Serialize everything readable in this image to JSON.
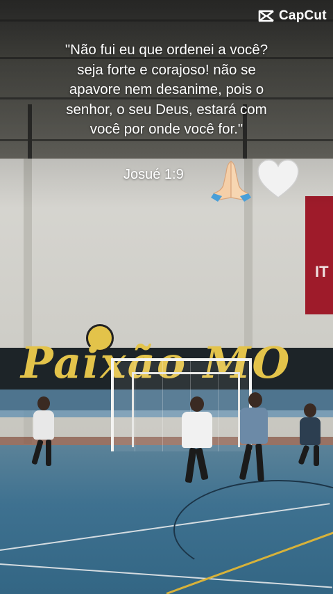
{
  "watermark": {
    "brand": "CapCut",
    "icon": "capcut-logo-icon"
  },
  "quote": {
    "lines": [
      "\"Não fui eu que ordenei a você?",
      "seja forte e corajoso! não se",
      "apavore nem desanime, pois o",
      "senhor, o seu Deus, estará com",
      "você por onde você for.\""
    ],
    "reference": "Josué 1:9"
  },
  "emojis": [
    {
      "name": "praying-hands-icon",
      "color": "#f5cfa8",
      "sleeve": "#4a9fd8"
    },
    {
      "name": "white-heart-icon",
      "color": "#f2f2f2"
    }
  ],
  "colors": {
    "text": "#ffffff",
    "floor": "#3e7190",
    "mural_text": "#e3c34a",
    "banner": "#9e1b2a"
  }
}
